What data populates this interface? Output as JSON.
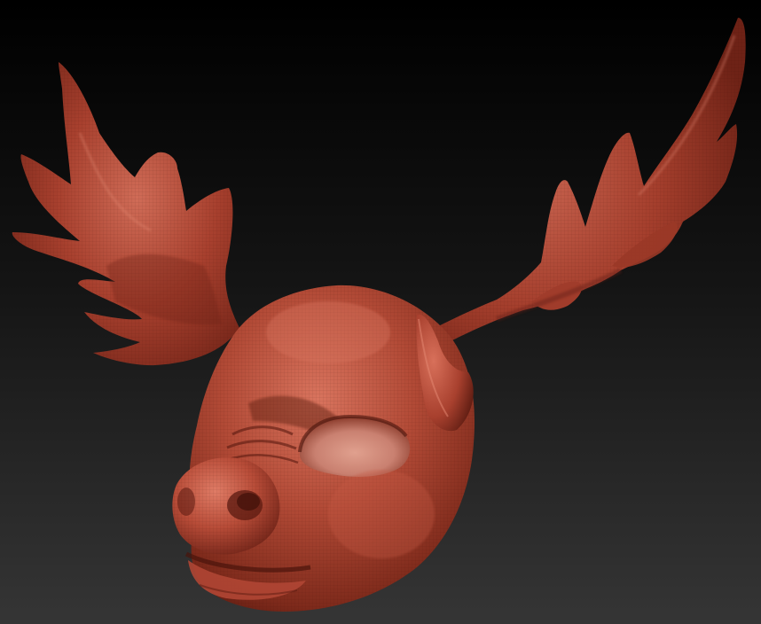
{
  "scene": {
    "subject": "moose-mask-sculpt",
    "material": {
      "base": "#a8402e",
      "light": "#d9745e",
      "mid": "#b24a36",
      "dark": "#6e2216",
      "deep": "#3e1009"
    },
    "background": {
      "top": "#000000",
      "mid": "#141414",
      "bottom": "#353535"
    },
    "show_wireframe": true
  }
}
